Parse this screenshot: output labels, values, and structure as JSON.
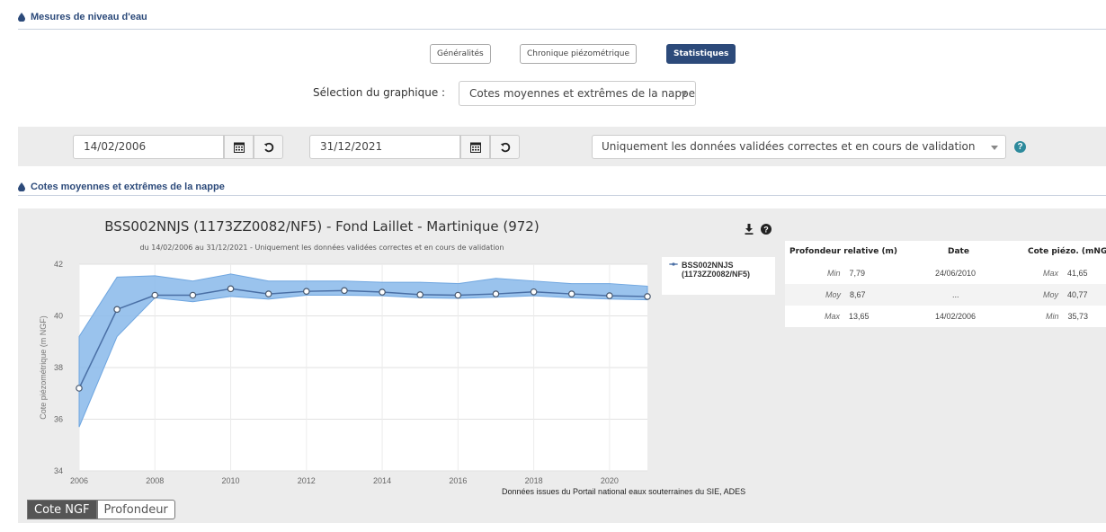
{
  "header": {
    "section_title": "Mesures de niveau d'eau"
  },
  "tabs": [
    {
      "label": "Généralités",
      "active": false
    },
    {
      "label": "Chronique piézométrique",
      "active": false
    },
    {
      "label": "Statistiques",
      "active": true
    }
  ],
  "chart_select": {
    "label": "Sélection du graphique :",
    "value": "Cotes moyennes et extrêmes de la nappe"
  },
  "filters": {
    "start_date": "14/02/2006",
    "end_date": "31/12/2021",
    "validation": "Uniquement les données validées correctes et en cours de validation"
  },
  "chart_section": {
    "title": "Cotes moyennes et extrêmes de la nappe"
  },
  "chart_data": {
    "type": "line",
    "title": "BSS002NNJS (1173ZZ0082/NF5) - Fond Laillet - Martinique (972)",
    "subtitle": "du 14/02/2006 au 31/12/2021 - Uniquement les données validées correctes et en cours de validation",
    "ylabel": "Cote piézométrique (m NGF)",
    "xlabel": "",
    "ylim": [
      34,
      42
    ],
    "xlim": [
      2006,
      2021
    ],
    "x_ticks": [
      2006,
      2008,
      2010,
      2012,
      2014,
      2016,
      2018,
      2020
    ],
    "y_ticks": [
      34,
      36,
      38,
      40,
      42
    ],
    "grid": true,
    "legend_position": "right",
    "series": [
      {
        "name": "BSS002NNJS (1173ZZ0082/NF5)",
        "color": "#4a6fa5",
        "x": [
          2006,
          2007,
          2008,
          2009,
          2010,
          2011,
          2012,
          2013,
          2014,
          2015,
          2016,
          2017,
          2018,
          2019,
          2020,
          2021
        ],
        "values": [
          37.2,
          40.25,
          40.8,
          40.8,
          41.05,
          40.85,
          40.95,
          40.98,
          40.92,
          40.82,
          40.8,
          40.85,
          40.93,
          40.85,
          40.78,
          40.75
        ]
      }
    ],
    "range": {
      "color": "#88b8ea",
      "min": [
        35.7,
        39.2,
        40.7,
        40.55,
        40.75,
        40.65,
        40.8,
        40.8,
        40.78,
        40.7,
        40.68,
        40.72,
        40.78,
        40.7,
        40.65,
        40.62
      ],
      "max": [
        39.2,
        41.5,
        41.55,
        41.35,
        41.62,
        41.35,
        41.35,
        41.35,
        41.3,
        41.3,
        41.25,
        41.45,
        41.35,
        41.25,
        41.25,
        41.15
      ]
    },
    "source": "Données issues du Portail national eaux souterraines du SIE, ADES"
  },
  "stats": {
    "headers": [
      "Profondeur relative (m)",
      "Date",
      "Cote piézo. (mNGF)"
    ],
    "rows": [
      {
        "p_label": "Min",
        "p_value": "7,79",
        "date": "24/06/2010",
        "c_label": "Max",
        "c_value": "41,65"
      },
      {
        "p_label": "Moy",
        "p_value": "8,67",
        "date": "...",
        "c_label": "Moy",
        "c_value": "40,77"
      },
      {
        "p_label": "Max",
        "p_value": "13,65",
        "date": "14/02/2006",
        "c_label": "Min",
        "c_value": "35,73"
      }
    ]
  },
  "toggle": {
    "cote": "Cote NGF",
    "profondeur": "Profondeur"
  },
  "icons": {
    "section": "water-drop-icon",
    "calendar": "calendar-icon",
    "reset": "reset-icon",
    "help": "help-icon",
    "download": "download-icon"
  },
  "colors": {
    "accent": "#2c4a7a",
    "help": "#2d8a9c",
    "line": "#4a6fa5",
    "band": "#88b8ea"
  }
}
